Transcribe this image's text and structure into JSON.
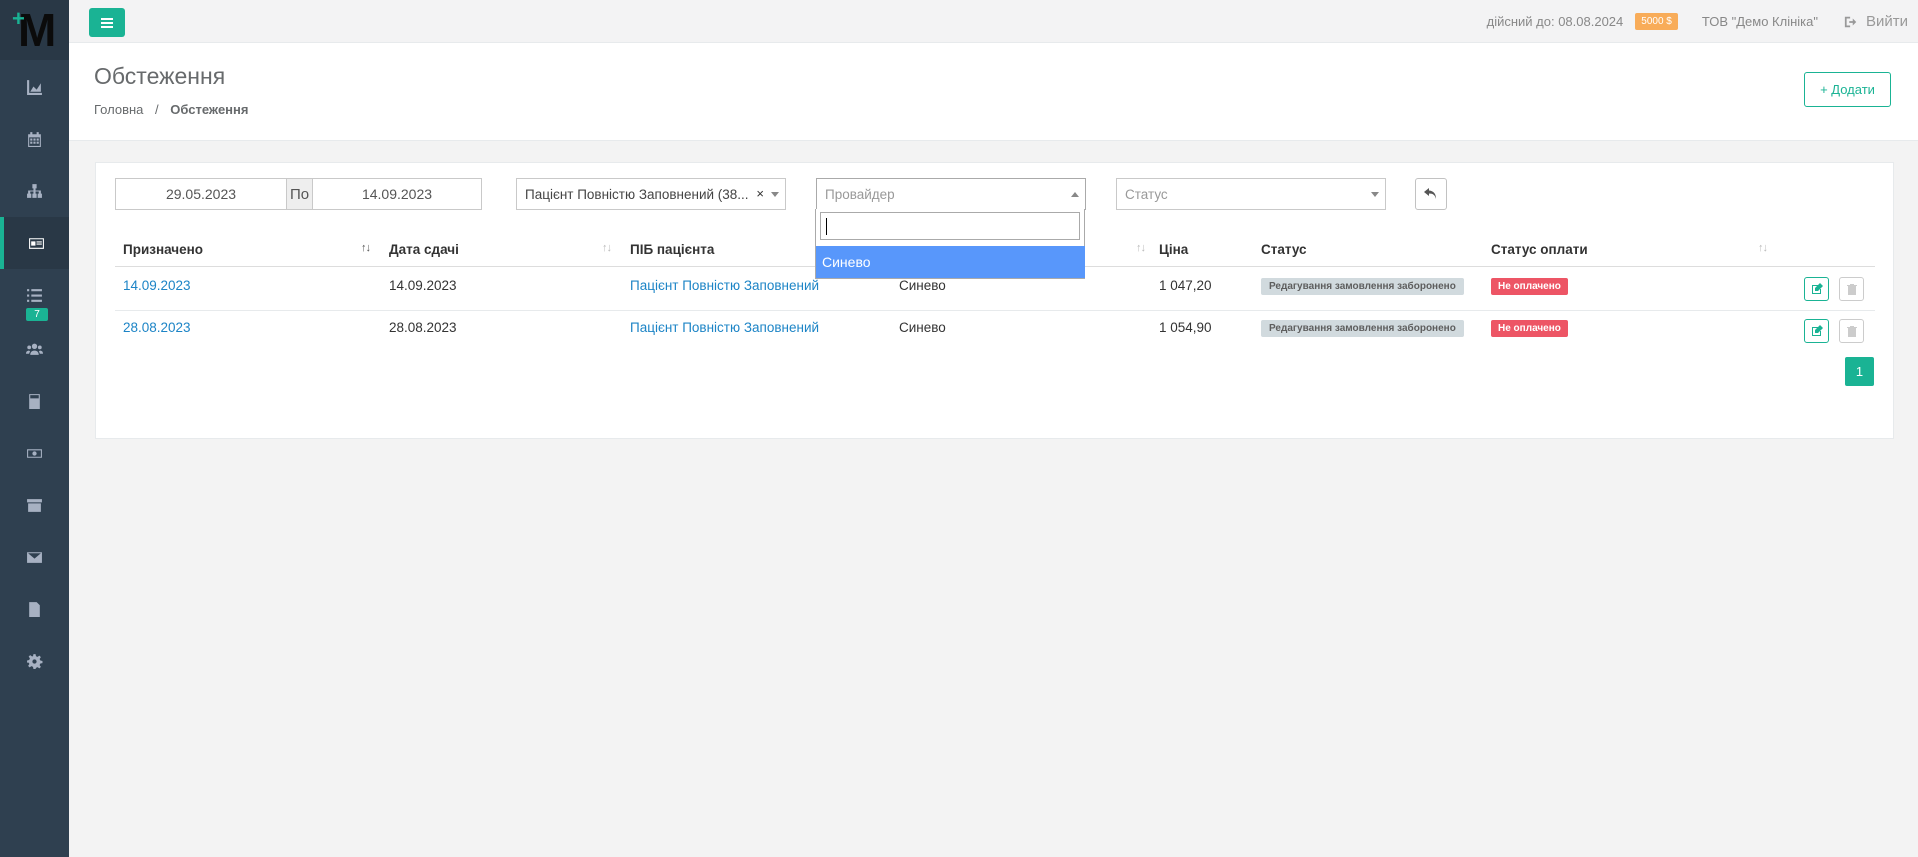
{
  "sidebar": {
    "logo_letter": "M",
    "logo_plus": "+",
    "items": [
      {
        "icon": "area-chart-icon"
      },
      {
        "icon": "calendar-icon"
      },
      {
        "icon": "sitemap-icon"
      },
      {
        "icon": "id-card-icon",
        "active": true
      },
      {
        "icon": "list-icon",
        "badge": "7"
      },
      {
        "icon": "users-icon"
      },
      {
        "icon": "calculator-icon"
      },
      {
        "icon": "money-icon"
      },
      {
        "icon": "archive-icon"
      },
      {
        "icon": "envelope-icon"
      },
      {
        "icon": "file-icon"
      },
      {
        "icon": "gear-icon"
      }
    ],
    "badge": "7"
  },
  "topbar": {
    "valid_until": "дійсний до: 08.08.2024",
    "money_badge": "5000 $",
    "org": "ТОВ \"Демо Клініка\"",
    "logout": "Вийти"
  },
  "header": {
    "title": "Обстеження",
    "breadcrumb_home": "Головна",
    "breadcrumb_sep": "/",
    "breadcrumb_current": "Обстеження",
    "add_button": "+ Додати"
  },
  "filters": {
    "date_from": "29.05.2023",
    "date_sep": "По",
    "date_to": "14.09.2023",
    "patient": "Пацієнт Повністю Заповнений (38...",
    "patient_clear": "×",
    "provider_placeholder": "Провайдер",
    "status_placeholder": "Статус"
  },
  "dropdown": {
    "search_value": "",
    "options": [
      "Синево"
    ]
  },
  "table": {
    "headers": [
      "Призначено",
      "Дата сдачі",
      "ПІБ пацієнта",
      "",
      "Ціна",
      "Статус",
      "Статус оплати"
    ],
    "rows": [
      {
        "assigned": "14.09.2023",
        "submitted": "14.09.2023",
        "patient": "Пацієнт Повністю Заповнений",
        "provider": "Синево",
        "price": "1 047,20",
        "status": "Редагування замовлення заборонено",
        "payment": "Не оплачено"
      },
      {
        "assigned": "28.08.2023",
        "submitted": "28.08.2023",
        "patient": "Пацієнт Повністю Заповнений",
        "provider": "Синево",
        "price": "1 054,90",
        "status": "Редагування замовлення заборонено",
        "payment": "Не оплачено"
      }
    ]
  },
  "pagination": {
    "current": "1"
  },
  "colors": {
    "accent": "#1ab394",
    "sidebar": "#2f4050",
    "link": "#1c84c6",
    "danger": "#ed5565",
    "warning": "#f8ac59",
    "highlight": "#5897fb"
  }
}
